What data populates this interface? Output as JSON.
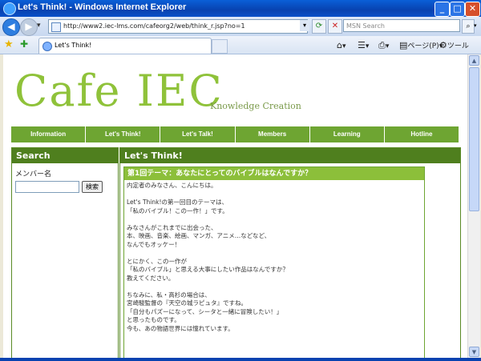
{
  "window": {
    "title": "Let's Think! - Windows Internet Explorer",
    "minimize": "_",
    "maximize": "□",
    "close": "✕"
  },
  "address": {
    "url": "http://www2.iec-lms.com/cafeorg2/web/think_r.jsp?no=1",
    "search_placeholder": "MSN Search"
  },
  "tabs": [
    {
      "label": "Let's Think!"
    }
  ],
  "commands": {
    "page": "ページ(P)",
    "tools": "ツール(O)"
  },
  "site": {
    "logo": "Cafe IEC",
    "tagline": "Knowledge Creation",
    "nav": [
      "Information",
      "Let's Think!",
      "Let's Talk!",
      "Members",
      "Learning",
      "Hotline"
    ]
  },
  "sidebar": {
    "title": "Search",
    "label": "メンバー名",
    "button": "検索",
    "input_value": ""
  },
  "main": {
    "title": "Let's Think!",
    "topic_title": "第1回テーマ：あなたにとってのバイブルはなんですか？",
    "body_lines": [
      "内定者のみなさん、こんにちは。",
      "",
      "Let's Think!の第一回目のテーマは、",
      "「私のバイブル！この一作！」です。",
      "",
      "みなさんがこれまでに出会った、",
      "本、映画、音楽、絵画、マンガ、アニメ…などなど、",
      "なんでもオッケー！",
      "",
      "とにかく、この一作が",
      "「私のバイブル」と思える大事にしたい作品はなんですか？",
      "教えてください。",
      "",
      "ちなみに、私・高杉の場合は、",
      "宮崎駿監督の『天空の城ラピュタ』ですね。",
      "「自分もパズーになって、シータと一緒に冒険したい！」",
      "と思ったものです。",
      "今も、あの物語世界には憧れています。"
    ]
  }
}
